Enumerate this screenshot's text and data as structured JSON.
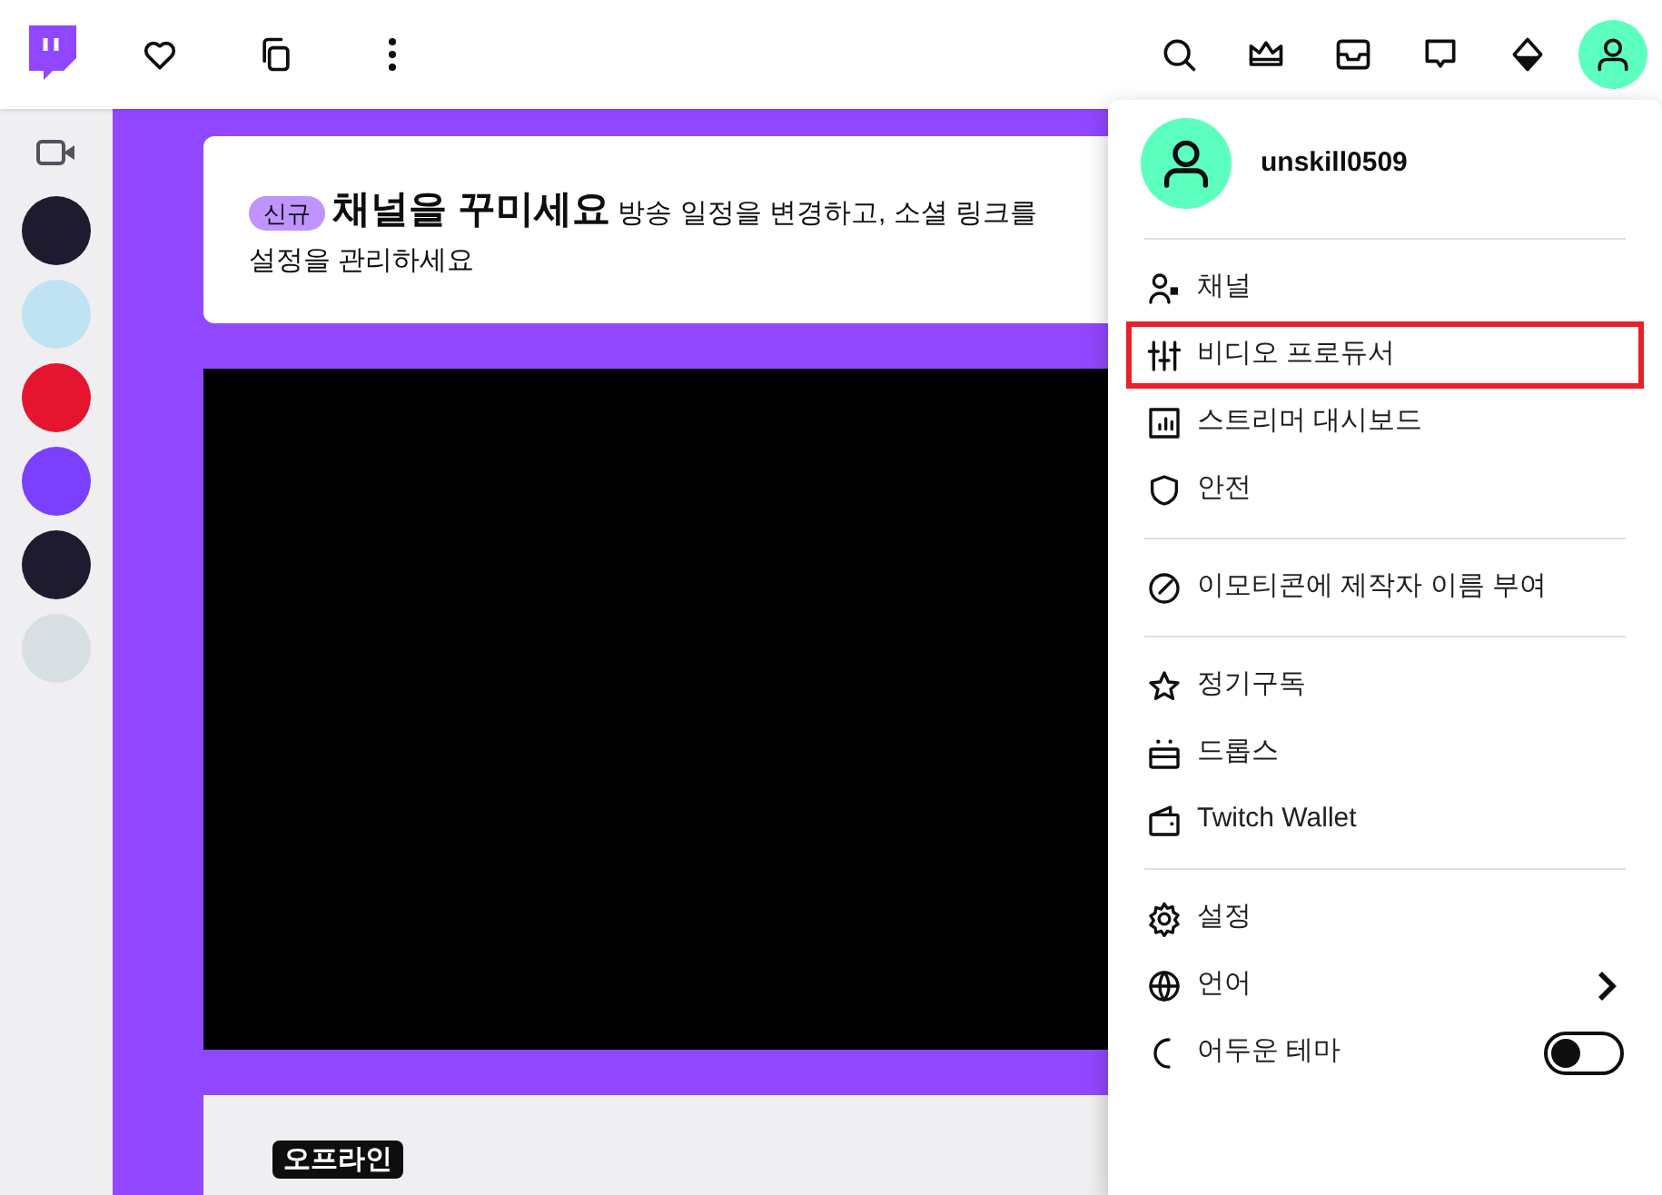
{
  "sidebar": {
    "channels": [
      {
        "color": "#1f1b2e"
      },
      {
        "color": "#bfe3f2"
      },
      {
        "color": "#e5142f"
      },
      {
        "color": "#7b3fff"
      },
      {
        "color": "#1f1b2e"
      },
      {
        "color": "#d9dee2"
      }
    ]
  },
  "banner": {
    "badge": "신규",
    "title": "채널을 꾸미세요",
    "text": "방송 일정을 변경하고, 소셜 링크를",
    "text_line2": "설정을 관리하세요"
  },
  "status_badge": "오프라인",
  "menu": {
    "username": "unskill0509",
    "groups": [
      [
        {
          "kind": "link",
          "label": "채널",
          "highlighted": false
        },
        {
          "kind": "link",
          "label": "비디오 프로듀서",
          "highlighted": true
        },
        {
          "kind": "link",
          "label": "스트리머 대시보드",
          "highlighted": false
        },
        {
          "kind": "link",
          "label": "안전",
          "highlighted": false
        }
      ],
      [
        {
          "kind": "link",
          "label": "이모티콘에 제작자 이름 부여",
          "highlighted": false
        }
      ],
      [
        {
          "kind": "link",
          "label": "정기구독",
          "highlighted": false
        },
        {
          "kind": "link",
          "label": "드롭스",
          "highlighted": false
        },
        {
          "kind": "link",
          "label": "Twitch Wallet",
          "highlighted": false
        }
      ],
      [
        {
          "kind": "link",
          "label": "설정",
          "highlighted": false
        },
        {
          "kind": "submenu",
          "label": "언어",
          "highlighted": false
        },
        {
          "kind": "toggle",
          "label": "어두운 테마",
          "highlighted": false,
          "on": false
        }
      ]
    ]
  }
}
